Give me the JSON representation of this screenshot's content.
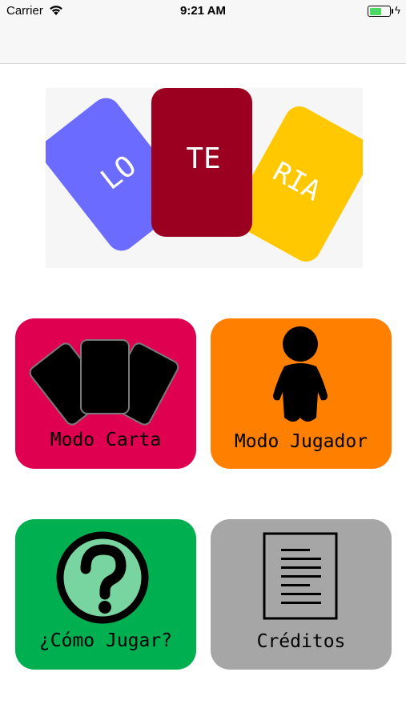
{
  "status_bar": {
    "carrier": "Carrier",
    "time": "9:21 AM",
    "battery_level": 0.55,
    "charging_icon": "bolt-icon"
  },
  "logo": {
    "cards": [
      {
        "text": "LO",
        "color": "#6b6bff"
      },
      {
        "text": "TE",
        "color": "#9b0020"
      },
      {
        "text": "RIA",
        "color": "#ffc800"
      }
    ]
  },
  "menu": {
    "modo_carta": {
      "label": "Modo Carta",
      "color": "#df0050",
      "icon": "cards-icon"
    },
    "modo_jugador": {
      "label": "Modo Jugador",
      "color": "#ff8000",
      "icon": "person-icon"
    },
    "como_jugar": {
      "label": "¿Cómo Jugar?",
      "color": "#00b050",
      "icon": "question-icon"
    },
    "creditos": {
      "label": "Créditos",
      "color": "#a6a6a6",
      "icon": "document-icon"
    }
  }
}
